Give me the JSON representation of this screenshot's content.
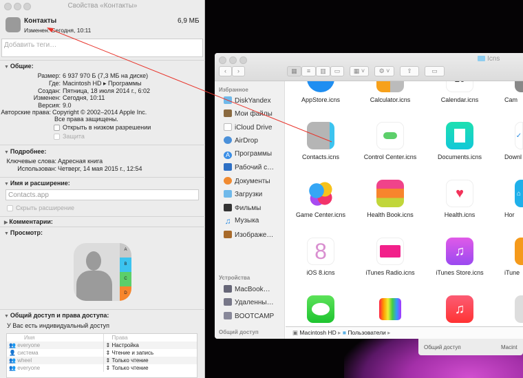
{
  "info_window": {
    "title": "Свойства «Контакты»",
    "name": "Контакты",
    "size": "6,9 МБ",
    "modified": "Изменен: Сегодня, 10:11",
    "tags_placeholder": "Добавить теги…",
    "general": {
      "header": "Общие:",
      "rows": [
        {
          "k": "Размер:",
          "v": "6 937 970 Б (7,3 МБ на диске)"
        },
        {
          "k": "Где:",
          "v": "Macintosh HD ▸ Программы"
        },
        {
          "k": "Создан:",
          "v": "Пятница, 18 июля 2014 г., 6:02"
        },
        {
          "k": "Изменен:",
          "v": "Сегодня, 10:11"
        },
        {
          "k": "Версия:",
          "v": "9.0"
        },
        {
          "k": "Авторские права:",
          "v": "Copyright © 2002–2014 Apple Inc."
        }
      ],
      "rights_line2": "Все права защищены.",
      "low_res": "Открыть в низком разрешении",
      "locked": "Защита"
    },
    "more": {
      "header": "Подробнее:",
      "keywords_k": "Ключевые слова:",
      "keywords_v": "Адресная книга",
      "used_k": "Использован:",
      "used_v": "Четверг, 14 мая 2015 г., 12:54"
    },
    "name_ext": {
      "header": "Имя и расширение:",
      "value": "Contacts.app",
      "hide_ext": "Скрыть расширение"
    },
    "comments": {
      "header": "Комментарии:"
    },
    "preview": {
      "header": "Просмотр:",
      "tabs": [
        "A",
        "B",
        "C",
        "D"
      ]
    },
    "sharing": {
      "header": "Общий доступ и права доступа:",
      "note": "У Вас есть индивидуальный доступ",
      "col_name": "Имя",
      "col_priv": "Права",
      "rows": [
        {
          "name": "everyone",
          "priv": "Настройка"
        },
        {
          "name": "система",
          "priv": "Чтение и запись"
        },
        {
          "name": "wheel",
          "priv": "Только чтение"
        },
        {
          "name": "everyone",
          "priv": "Только чтение"
        }
      ]
    }
  },
  "finder": {
    "title": "Icns",
    "favorites_header": "Избранное",
    "favorites": [
      "DiskYandex",
      "Мои файлы",
      "iCloud Drive",
      "AirDrop",
      "Программы",
      "Рабочий с…",
      "Документы",
      "Загрузки",
      "Фильмы",
      "Музыка",
      "Изображе…"
    ],
    "devices_header": "Устройства",
    "devices": [
      "MacBook…",
      "Удаленны…",
      "BOOTCAMP"
    ],
    "shared_header": "Общий доступ",
    "files": [
      "AppStore.icns",
      "Calculator.icns",
      "Calendar.icns",
      "Cam",
      "Contacts.icns",
      "Control Center.icns",
      "Documents.icns",
      "Downl",
      "Game Center.icns",
      "Health Book.icns",
      "Health.icns",
      "Hor",
      "iOS 8.icns",
      "iTunes Radio.icns",
      "iTunes Store.icns",
      "iTune"
    ],
    "path": [
      "Macintosh HD",
      "Пользователи"
    ]
  },
  "back_window": {
    "shared": "Общий доступ",
    "disk": "Macint"
  }
}
